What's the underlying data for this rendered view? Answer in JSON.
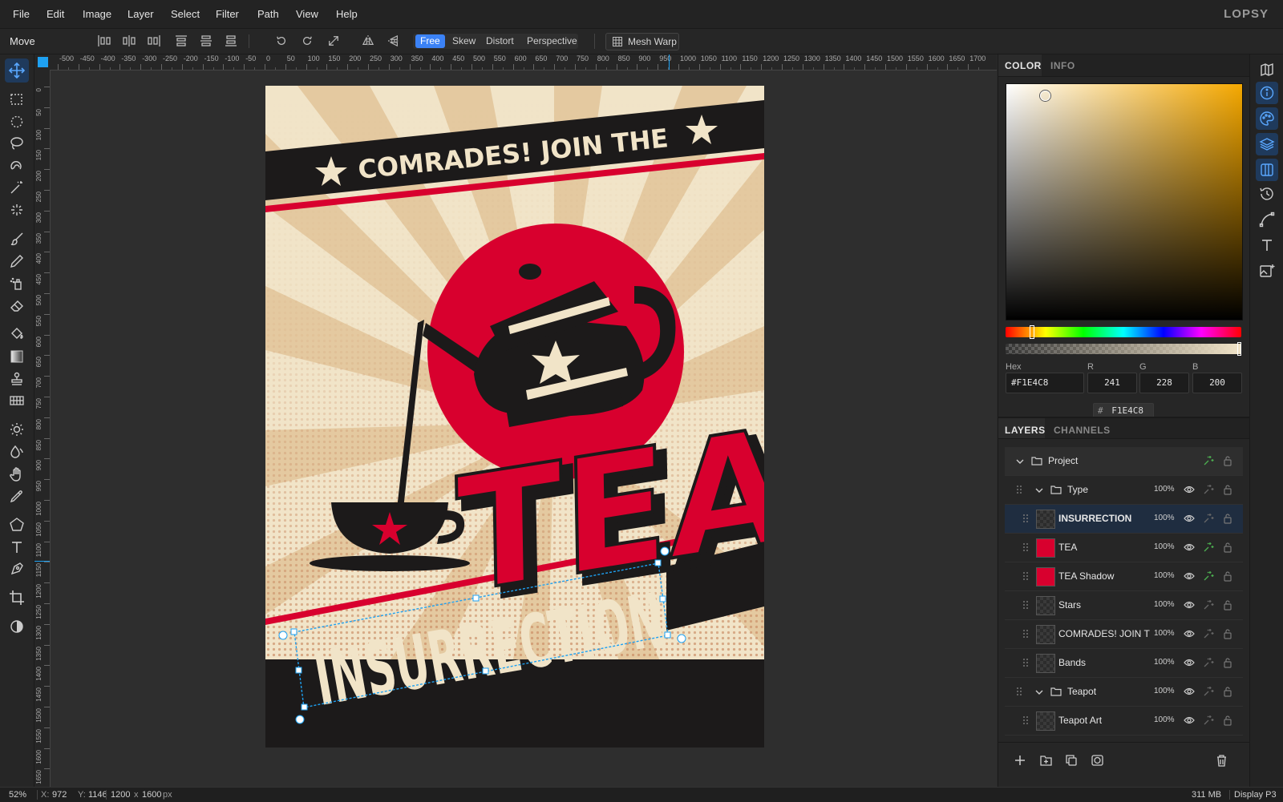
{
  "app": {
    "logo": "LOPSY"
  },
  "menu": [
    "File",
    "Edit",
    "Image",
    "Layer",
    "Select",
    "Filter",
    "Path",
    "View",
    "Help"
  ],
  "options": {
    "tool_name": "Move",
    "transform_modes": [
      {
        "label": "Free",
        "active": true
      },
      {
        "label": "Skew",
        "active": false
      },
      {
        "label": "Distort",
        "active": false
      },
      {
        "label": "Perspective",
        "active": false
      }
    ],
    "mesh_warp_label": "Mesh Warp"
  },
  "rulers": {
    "h_ticks": [
      "-500",
      "-450",
      "-400",
      "-350",
      "-300",
      "-250",
      "-200",
      "-150",
      "-100",
      "-50",
      "0",
      "50",
      "100",
      "150",
      "200",
      "250",
      "300",
      "350",
      "400",
      "450",
      "500",
      "550",
      "600",
      "650",
      "700",
      "750",
      "800",
      "850",
      "900",
      "950",
      "1000",
      "1050",
      "1100",
      "1150",
      "1200",
      "1250",
      "1300",
      "1350",
      "1400",
      "1450",
      "1500",
      "1550",
      "1600",
      "1650",
      "1700"
    ],
    "v_ticks": [
      "0",
      "50",
      "100",
      "150",
      "200",
      "250",
      "300",
      "350",
      "400",
      "450",
      "500",
      "550",
      "600",
      "650",
      "700",
      "750",
      "800",
      "850",
      "900",
      "950",
      "1000",
      "1050",
      "1100",
      "1150",
      "1200",
      "1250",
      "1300",
      "1350",
      "1400",
      "1450",
      "1500",
      "1550",
      "1600",
      "1650"
    ]
  },
  "poster": {
    "headline": "COMRADES! JOIN THE",
    "big_word": "TEA",
    "bottom_word": "INSURRECTION",
    "colors": {
      "cream": "#F1E4C8",
      "tan": "#E4C9A0",
      "red": "#D8002E",
      "black": "#1C1A1A"
    }
  },
  "color_panel": {
    "tabs": [
      {
        "label": "COLOR",
        "active": true
      },
      {
        "label": "INFO",
        "active": false
      }
    ],
    "hex_label": "Hex",
    "hex_value": "#F1E4C8",
    "r_label": "R",
    "r_value": "241",
    "g_label": "G",
    "g_value": "228",
    "b_label": "B",
    "b_value": "200",
    "swatch_hash": "#",
    "swatch_value": "F1E4C8",
    "hue_color": "#F5A800"
  },
  "layers_panel": {
    "tabs": [
      {
        "label": "LAYERS",
        "active": true
      },
      {
        "label": "CHANNELS",
        "active": false
      }
    ],
    "layers": [
      {
        "name": "Project",
        "group": true,
        "depth": 0,
        "opacity": "",
        "selected": false,
        "fx": true
      },
      {
        "name": "Type",
        "group": true,
        "depth": 1,
        "opacity": "100%",
        "selected": false,
        "fx": false
      },
      {
        "name": "INSURRECTION",
        "group": false,
        "depth": 2,
        "opacity": "100%",
        "selected": true,
        "fx": false
      },
      {
        "name": "TEA",
        "group": false,
        "depth": 2,
        "opacity": "100%",
        "selected": false,
        "fx": true
      },
      {
        "name": "TEA Shadow",
        "group": false,
        "depth": 2,
        "opacity": "100%",
        "selected": false,
        "fx": true
      },
      {
        "name": "Stars",
        "group": false,
        "depth": 2,
        "opacity": "100%",
        "selected": false,
        "fx": false
      },
      {
        "name": "COMRADES! JOIN T",
        "group": false,
        "depth": 2,
        "opacity": "100%",
        "selected": false,
        "fx": false
      },
      {
        "name": "Bands",
        "group": false,
        "depth": 2,
        "opacity": "100%",
        "selected": false,
        "fx": false
      },
      {
        "name": "Teapot",
        "group": true,
        "depth": 1,
        "opacity": "100%",
        "selected": false,
        "fx": false
      },
      {
        "name": "Teapot Art",
        "group": false,
        "depth": 2,
        "opacity": "100%",
        "selected": false,
        "fx": false
      }
    ]
  },
  "status": {
    "zoom": "52%",
    "x_label": "X:",
    "x_value": "972",
    "y_label": "Y:",
    "y_value": "1146",
    "size_w": "1200",
    "size_sep": "x",
    "size_h": "1600",
    "size_unit": "px",
    "memory": "311 MB",
    "profile": "Display P3"
  }
}
